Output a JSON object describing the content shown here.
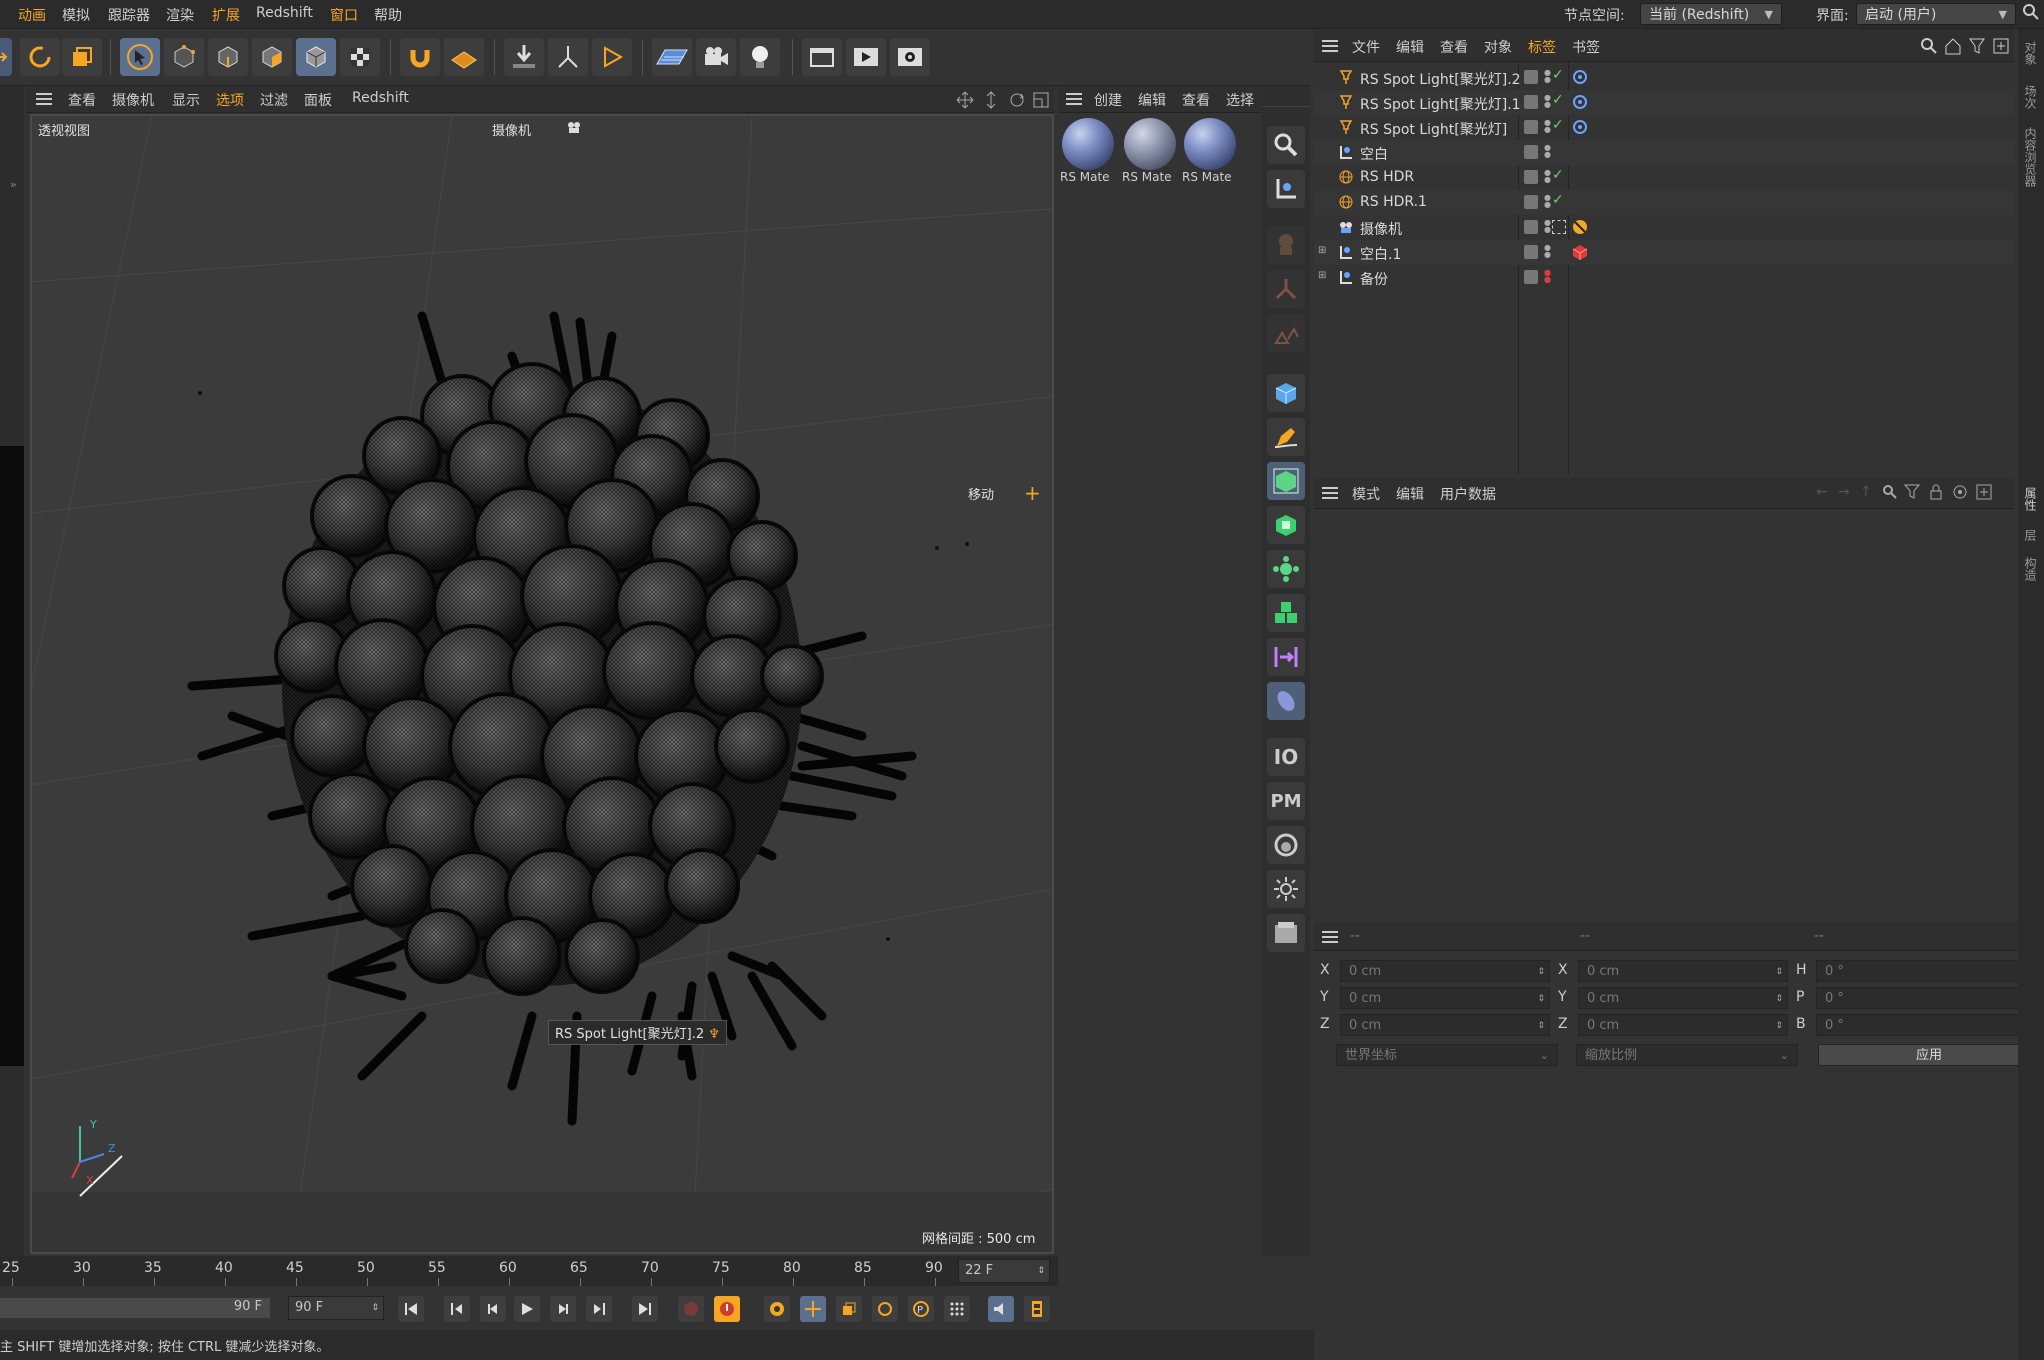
{
  "menubar": {
    "items": [
      "动画",
      "模拟",
      "跟踪器",
      "渲染",
      "扩展",
      "Redshift",
      "窗口",
      "帮助"
    ],
    "active_items": [
      "动画",
      "扩展",
      "窗口"
    ],
    "node_space_label": "节点空间:",
    "node_space_value": "当前 (Redshift)",
    "layout_label": "界面:",
    "layout_value": "启动 (用户)"
  },
  "viewport": {
    "menu": [
      "查看",
      "摄像机",
      "显示",
      "选项",
      "过滤",
      "面板",
      "Redshift"
    ],
    "active_menu": "选项",
    "view_name": "透视视图",
    "camera_label": "摄像机",
    "move_label": "移动",
    "light_tooltip": "RS Spot Light[聚光灯].2",
    "grid_spacing": "网格间距 : 500 cm",
    "axis_labels": {
      "y": "Y",
      "z": "Z",
      "x": "X"
    }
  },
  "material_panel": {
    "menu": [
      "创建",
      "编辑",
      "查看",
      "选择"
    ],
    "materials": [
      "RS Mate",
      "RS Mate",
      "RS Mate"
    ]
  },
  "object_manager": {
    "menu": [
      "文件",
      "编辑",
      "查看",
      "对象",
      "标签",
      "书签"
    ],
    "active_menu": "标签",
    "objects": [
      {
        "name": "RS Spot Light[聚光灯].2",
        "icon": "spotlight-icon",
        "tag": "target-tag-icon",
        "check": true,
        "expand": false
      },
      {
        "name": "RS Spot Light[聚光灯].1",
        "icon": "spotlight-icon",
        "tag": "target-tag-icon",
        "check": true,
        "expand": false
      },
      {
        "name": "RS Spot Light[聚光灯]",
        "icon": "spotlight-icon",
        "tag": "target-tag-icon",
        "check": true,
        "expand": false
      },
      {
        "name": "空白",
        "icon": "null-icon",
        "tag": "",
        "check": false,
        "expand": false
      },
      {
        "name": "RS HDR",
        "icon": "globe-icon",
        "tag": "",
        "check": true,
        "expand": false
      },
      {
        "name": "RS HDR.1",
        "icon": "globe-icon",
        "tag": "",
        "check": true,
        "expand": false
      },
      {
        "name": "摄像机",
        "icon": "camera-icon",
        "tag": "protection-tag-icon",
        "check": false,
        "expand": false
      },
      {
        "name": "空白.1",
        "icon": "null-icon",
        "tag": "cube-tag-icon",
        "check": false,
        "expand": true
      },
      {
        "name": "备份",
        "icon": "null-icon",
        "tag": "",
        "check": false,
        "expand": true,
        "red_dot": true
      }
    ]
  },
  "attributes": {
    "menu": [
      "模式",
      "编辑",
      "用户数据"
    ]
  },
  "coordinates": {
    "headers": [
      "--",
      "--",
      "--"
    ],
    "rows": [
      {
        "a": "X",
        "av": "0 cm",
        "b": "X",
        "bv": "0 cm",
        "c": "H",
        "cv": "0 °"
      },
      {
        "a": "Y",
        "av": "0 cm",
        "b": "Y",
        "bv": "0 cm",
        "c": "P",
        "cv": "0 °"
      },
      {
        "a": "Z",
        "av": "0 cm",
        "b": "Z",
        "bv": "0 cm",
        "c": "B",
        "cv": "0 °"
      }
    ],
    "coord_system": "世界坐标",
    "scale_mode": "缩放比例",
    "apply_label": "应用"
  },
  "timeline": {
    "ticks": [
      "25",
      "30",
      "35",
      "40",
      "45",
      "50",
      "55",
      "60",
      "65",
      "70",
      "75",
      "80",
      "85",
      "90"
    ],
    "current_frame": "22 F",
    "end_frame_a": "90 F",
    "end_frame_b": "90 F"
  },
  "status_text": "主 SHIFT 键增加选择对象; 按住 CTRL 键减少选择对象。",
  "edge_tabs": [
    "对象",
    "场次",
    "内容浏览器",
    "属性",
    "层",
    "构造"
  ],
  "colors": {
    "accent": "#f5a623",
    "selected": "#5b6f8f",
    "check": "#6fd06f",
    "target": "#6aa3ff"
  }
}
